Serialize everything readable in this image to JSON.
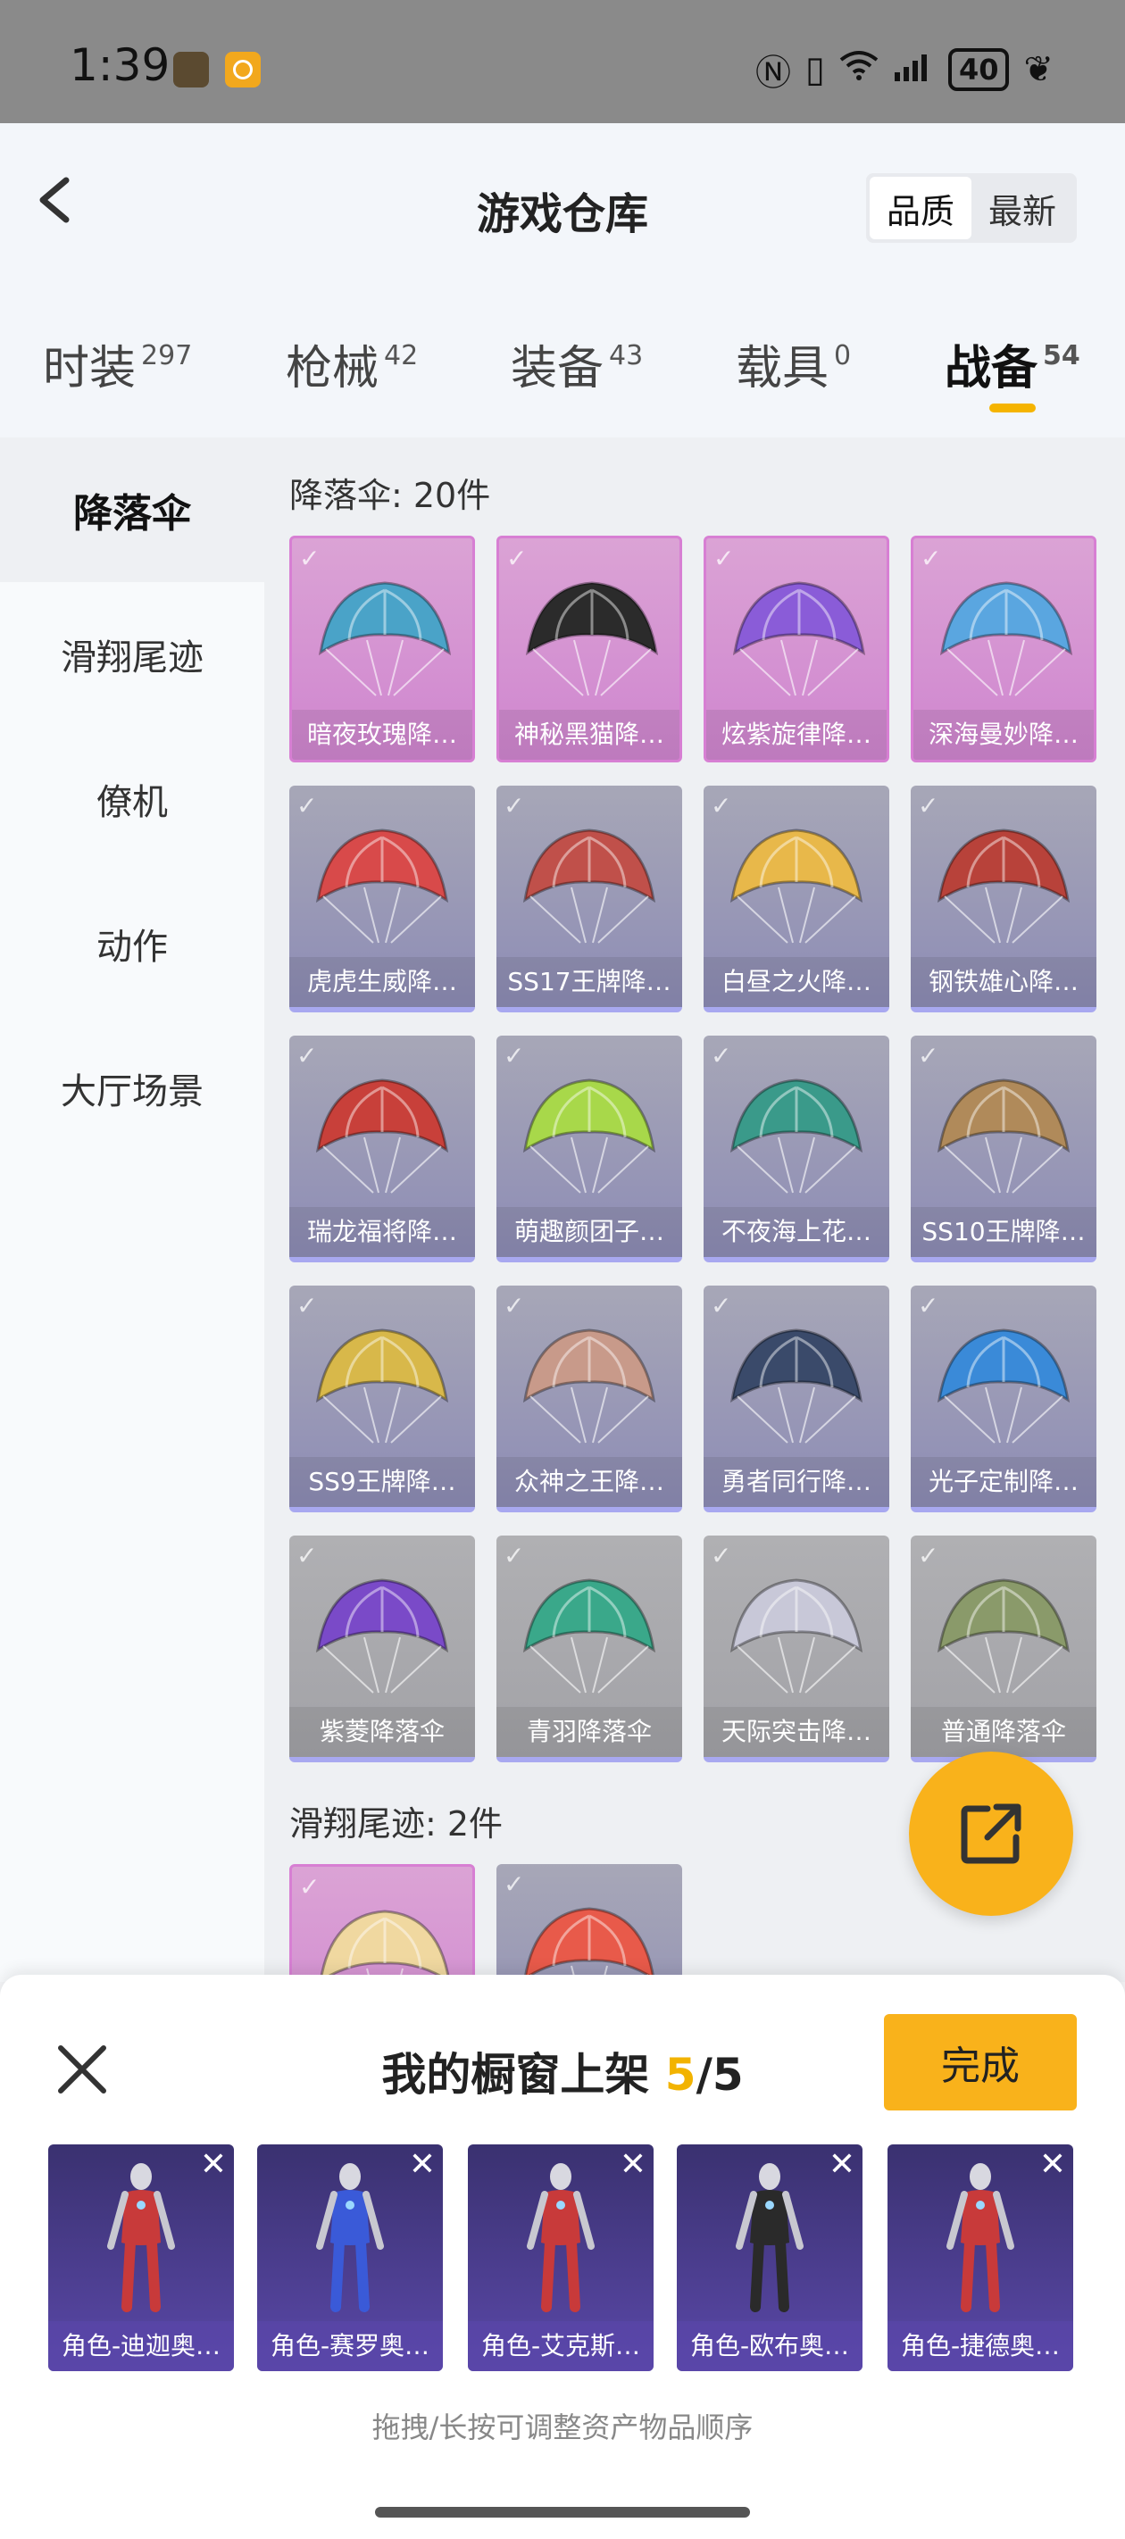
{
  "status_bar": {
    "time": "1:39",
    "battery": "40",
    "icons": [
      "nfc-icon",
      "vibrate-icon",
      "wifi-icon",
      "signal-icon",
      "battery-icon",
      "leaf-icon"
    ]
  },
  "header": {
    "title": "游戏仓库",
    "sort_options": [
      "品质",
      "最新"
    ],
    "active_sort": "品质"
  },
  "tabs": [
    {
      "label": "时装",
      "count": "297"
    },
    {
      "label": "枪械",
      "count": "42"
    },
    {
      "label": "装备",
      "count": "43"
    },
    {
      "label": "载具",
      "count": "0"
    },
    {
      "label": "战备",
      "count": "54"
    }
  ],
  "active_tab": "战备",
  "sidebar": {
    "items": [
      "降落伞",
      "滑翔尾迹",
      "僚机",
      "动作",
      "大厅场景"
    ],
    "active": "降落伞"
  },
  "sections": [
    {
      "title": "降落伞: 20件",
      "items": [
        {
          "label": "暗夜玫瑰降…",
          "tier": "pink",
          "color": "#4aa3c8"
        },
        {
          "label": "神秘黑猫降…",
          "tier": "pink",
          "color": "#2b2b2b"
        },
        {
          "label": "炫紫旋律降…",
          "tier": "pink",
          "color": "#8a5cd8"
        },
        {
          "label": "深海曼妙降…",
          "tier": "pink",
          "color": "#5aa6e0"
        },
        {
          "label": "虎虎生威降…",
          "tier": "purple",
          "color": "#d84a4a"
        },
        {
          "label": "SS17王牌降…",
          "tier": "purple",
          "color": "#c0504a"
        },
        {
          "label": "白昼之火降…",
          "tier": "purple",
          "color": "#e8b84a"
        },
        {
          "label": "钢铁雄心降…",
          "tier": "purple",
          "color": "#b8423a"
        },
        {
          "label": "瑞龙福将降…",
          "tier": "purple",
          "color": "#c8403a"
        },
        {
          "label": "萌趣颜团子…",
          "tier": "purple",
          "color": "#a8d84a"
        },
        {
          "label": "不夜海上花…",
          "tier": "purple",
          "color": "#3a9a8a"
        },
        {
          "label": "SS10王牌降…",
          "tier": "purple",
          "color": "#b08a5a"
        },
        {
          "label": "SS9王牌降…",
          "tier": "purple",
          "color": "#d8b84a"
        },
        {
          "label": "众神之王降…",
          "tier": "purple",
          "color": "#c89a8a"
        },
        {
          "label": "勇者同行降…",
          "tier": "purple",
          "color": "#3a4a6a"
        },
        {
          "label": "光子定制降…",
          "tier": "purple",
          "color": "#3a8ad8"
        },
        {
          "label": "紫菱降落伞",
          "tier": "gray",
          "color": "#7a4ac8"
        },
        {
          "label": "青羽降落伞",
          "tier": "gray",
          "color": "#3aa88a"
        },
        {
          "label": "天际突击降…",
          "tier": "gray",
          "color": "#c8c8d8"
        },
        {
          "label": "普通降落伞",
          "tier": "gray",
          "color": "#8a9a6a"
        }
      ]
    },
    {
      "title": "滑翔尾迹: 2件",
      "items": [
        {
          "label": "",
          "tier": "pink",
          "color": "#f0d8a0"
        },
        {
          "label": "",
          "tier": "purple",
          "color": "#e85a4a"
        }
      ]
    }
  ],
  "panel": {
    "title": "我的橱窗上架",
    "count": "5",
    "total": "/5",
    "done_label": "完成",
    "hint": "拖拽/长按可调整资产物品顺序",
    "slots": [
      {
        "label": "角色-迪迦奥…",
        "color": "#c83a3a"
      },
      {
        "label": "角色-赛罗奥…",
        "color": "#3a5ad8"
      },
      {
        "label": "角色-艾克斯…",
        "color": "#c83a3a"
      },
      {
        "label": "角色-欧布奥…",
        "color": "#2a2a2a"
      },
      {
        "label": "角色-捷德奥…",
        "color": "#c83a3a"
      }
    ]
  }
}
